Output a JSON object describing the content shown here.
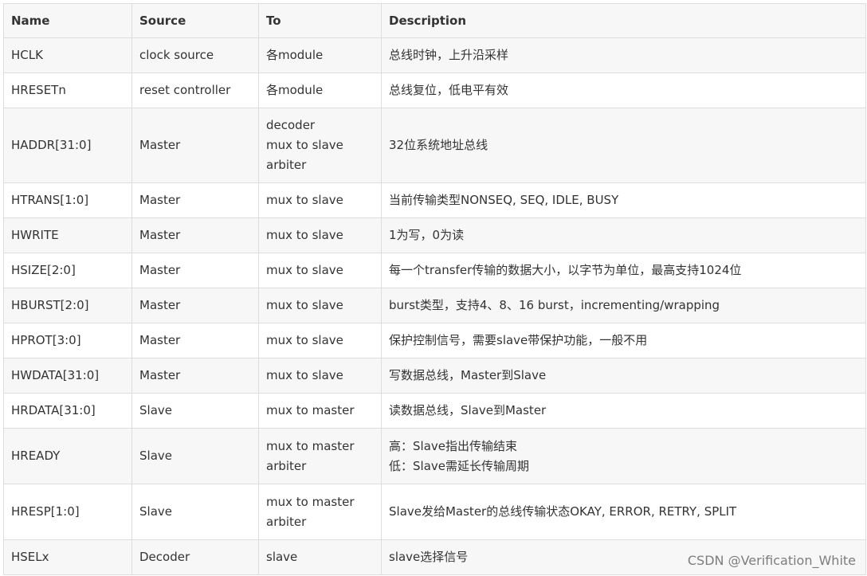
{
  "table": {
    "headers": [
      "Name",
      "Source",
      "To",
      "Description"
    ],
    "rows": [
      {
        "name": "HCLK",
        "source": "clock source",
        "to": [
          "各module"
        ],
        "desc": [
          "总线时钟，上升沿采样"
        ]
      },
      {
        "name": "HRESETn",
        "source": "reset controller",
        "to": [
          "各module"
        ],
        "desc": [
          "总线复位，低电平有效"
        ]
      },
      {
        "name": "HADDR[31:0]",
        "source": "Master",
        "to": [
          "decoder",
          "mux to slave",
          "arbiter"
        ],
        "desc": [
          "32位系统地址总线"
        ]
      },
      {
        "name": "HTRANS[1:0]",
        "source": "Master",
        "to": [
          "mux to slave"
        ],
        "desc": [
          "当前传输类型NONSEQ, SEQ, IDLE, BUSY"
        ]
      },
      {
        "name": "HWRITE",
        "source": "Master",
        "to": [
          "mux to slave"
        ],
        "desc": [
          "1为写，0为读"
        ]
      },
      {
        "name": "HSIZE[2:0]",
        "source": "Master",
        "to": [
          "mux to slave"
        ],
        "desc": [
          "每一个transfer传输的数据大小，以字节为单位，最高支持1024位"
        ]
      },
      {
        "name": "HBURST[2:0]",
        "source": "Master",
        "to": [
          "mux to slave"
        ],
        "desc": [
          "burst类型，支持4、8、16 burst，incrementing/wrapping"
        ]
      },
      {
        "name": "HPROT[3:0]",
        "source": "Master",
        "to": [
          "mux to slave"
        ],
        "desc": [
          "保护控制信号，需要slave带保护功能，一般不用"
        ]
      },
      {
        "name": "HWDATA[31:0]",
        "source": "Master",
        "to": [
          "mux to slave"
        ],
        "desc": [
          "写数据总线，Master到Slave"
        ]
      },
      {
        "name": "HRDATA[31:0]",
        "source": "Slave",
        "to": [
          "mux to master"
        ],
        "desc": [
          "读数据总线，Slave到Master"
        ]
      },
      {
        "name": "HREADY",
        "source": "Slave",
        "to": [
          "mux to master",
          "arbiter"
        ],
        "desc": [
          "高：Slave指出传输结束",
          "低：Slave需延长传输周期"
        ]
      },
      {
        "name": "HRESP[1:0]",
        "source": "Slave",
        "to": [
          "mux to master",
          "arbiter"
        ],
        "desc": [
          "Slave发给Master的总线传输状态OKAY, ERROR, RETRY, SPLIT"
        ]
      },
      {
        "name": "HSELx",
        "source": "Decoder",
        "to": [
          "slave"
        ],
        "desc": [
          "slave选择信号"
        ]
      }
    ]
  },
  "watermark": "CSDN @Verification_White"
}
